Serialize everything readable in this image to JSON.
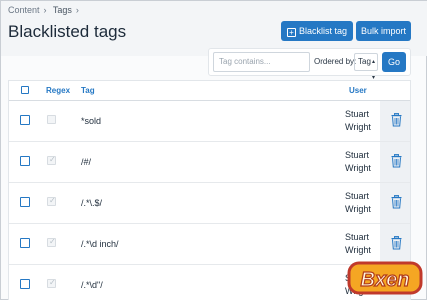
{
  "breadcrumb": {
    "items": [
      "Content",
      "Tags"
    ],
    "sep": "›"
  },
  "page": {
    "title": "Blacklisted tags"
  },
  "toolbar": {
    "blacklist_label": "Blacklist tag",
    "bulk_label": "Bulk import"
  },
  "filter": {
    "placeholder": "Tag contains...",
    "order_by_label": "Ordered by:",
    "order_value": "Tag",
    "go_label": "Go"
  },
  "table": {
    "headers": {
      "regex": "Regex",
      "tag": "Tag",
      "user": "User"
    },
    "rows": [
      {
        "regex": false,
        "tag": "*sold",
        "user_first": "Stuart",
        "user_last": "Wright"
      },
      {
        "regex": true,
        "tag": "/#/",
        "user_first": "Stuart",
        "user_last": "Wright"
      },
      {
        "regex": true,
        "tag": "/.*\\.$/",
        "user_first": "Stuart",
        "user_last": "Wright"
      },
      {
        "regex": true,
        "tag": "/.*\\d inch/",
        "user_first": "Stuart",
        "user_last": "Wright"
      },
      {
        "regex": true,
        "tag": "/.*\\d\"/",
        "user_first": "Stuart",
        "user_last": "Wright"
      }
    ]
  },
  "watermark": {
    "text": "Bxen"
  },
  "colors": {
    "accent": "#2578c4",
    "title": "#1d2b3a",
    "header_bg": "#f3f5f7"
  }
}
